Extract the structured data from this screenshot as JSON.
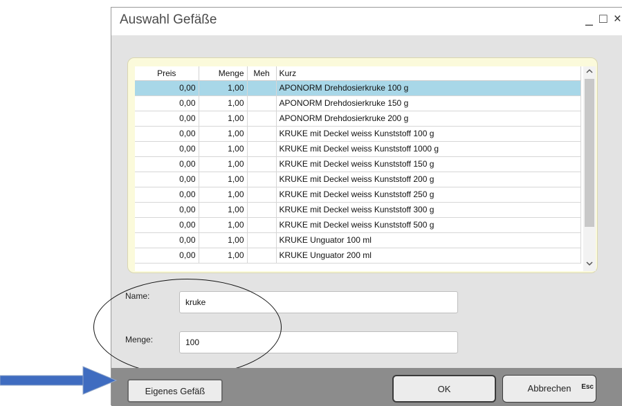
{
  "window": {
    "title": "Auswahl Gefäße",
    "minimize": "_",
    "maximize": "□",
    "close": "×"
  },
  "table": {
    "columns": {
      "preis": "Preis",
      "menge": "Menge",
      "meh": "Meh",
      "kurz": "Kurz"
    },
    "rows": [
      {
        "preis": "0,00",
        "menge": "1,00",
        "meh": "",
        "kurz": "APONORM Drehdosierkruke 100 g"
      },
      {
        "preis": "0,00",
        "menge": "1,00",
        "meh": "",
        "kurz": "APONORM Drehdosierkruke 150 g"
      },
      {
        "preis": "0,00",
        "menge": "1,00",
        "meh": "",
        "kurz": "APONORM Drehdosierkruke 200 g"
      },
      {
        "preis": "0,00",
        "menge": "1,00",
        "meh": "",
        "kurz": "KRUKE mit Deckel weiss Kunststoff 100 g"
      },
      {
        "preis": "0,00",
        "menge": "1,00",
        "meh": "",
        "kurz": "KRUKE mit Deckel weiss Kunststoff 1000 g"
      },
      {
        "preis": "0,00",
        "menge": "1,00",
        "meh": "",
        "kurz": "KRUKE mit Deckel weiss Kunststoff 150 g"
      },
      {
        "preis": "0,00",
        "menge": "1,00",
        "meh": "",
        "kurz": "KRUKE mit Deckel weiss Kunststoff 200 g"
      },
      {
        "preis": "0,00",
        "menge": "1,00",
        "meh": "",
        "kurz": "KRUKE mit Deckel weiss Kunststoff 250 g"
      },
      {
        "preis": "0,00",
        "menge": "1,00",
        "meh": "",
        "kurz": "KRUKE mit Deckel weiss Kunststoff 300 g"
      },
      {
        "preis": "0,00",
        "menge": "1,00",
        "meh": "",
        "kurz": "KRUKE mit Deckel weiss Kunststoff 500 g"
      },
      {
        "preis": "0,00",
        "menge": "1,00",
        "meh": "",
        "kurz": "KRUKE Unguator 100 ml"
      },
      {
        "preis": "0,00",
        "menge": "1,00",
        "meh": "",
        "kurz": "KRUKE Unguator 200 ml"
      }
    ],
    "selected_index": 0
  },
  "form": {
    "name_label": "Name:",
    "name_value": "kruke",
    "menge_label": "Menge:",
    "menge_value": "100"
  },
  "buttons": {
    "own_vessel": "Eigenes Gefäß",
    "ok": "OK",
    "cancel": "Abbrechen",
    "cancel_shortcut": "Esc"
  },
  "icons": {
    "scroll_up": "chevron-up-icon",
    "scroll_down": "chevron-down-icon",
    "annotation_arrow": "arrow-right-icon"
  },
  "colors": {
    "selected_row": "#a8d7e8",
    "list_panel": "#fbfadb",
    "bottom_bar": "#8c8c8c",
    "arrow": "#3f6cc0"
  }
}
